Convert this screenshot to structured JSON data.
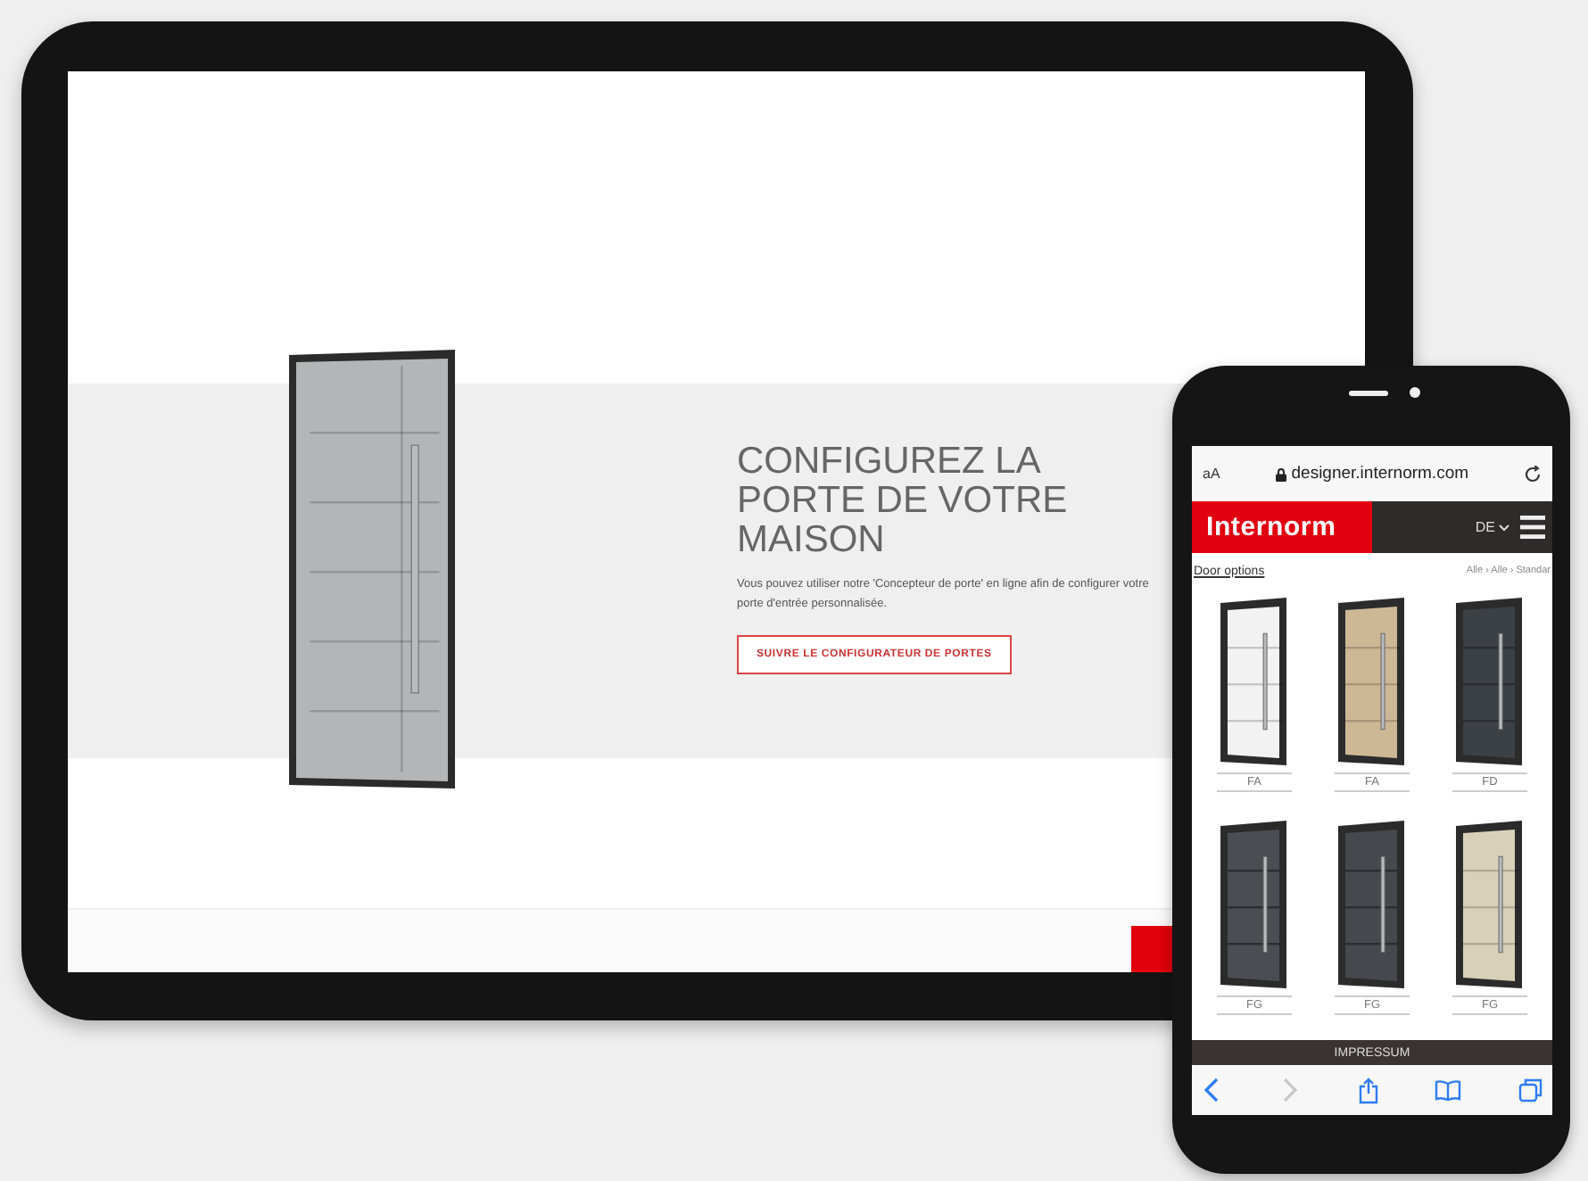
{
  "tablet": {
    "hero": {
      "title": "CONFIGUREZ LA PORTE DE VOTRE MAISON",
      "text": "Vous pouvez utiliser notre 'Concepteur de porte' en ligne afin de configurer votre porte d'entrée personnalisée.",
      "button": "SUIVRE LE CONFIGURATEUR DE PORTES"
    }
  },
  "phone": {
    "browser": {
      "text_size": "aA",
      "url": "designer.internorm.com"
    },
    "header": {
      "logo": "Internorm",
      "language": "DE"
    },
    "tab": "Door options",
    "breadcrumb": "Alle › Alle › Standar",
    "doors": [
      {
        "label": "FA",
        "color": "#f2f2f2"
      },
      {
        "label": "FA",
        "color": "#cdb896"
      },
      {
        "label": "FD",
        "color": "#3c4146"
      },
      {
        "label": "FG",
        "color": "#4a4e53"
      },
      {
        "label": "FG",
        "color": "#45494e"
      },
      {
        "label": "FG",
        "color": "#d8d0b8"
      }
    ],
    "footer": "IMPRESSUM",
    "toolbar": [
      {
        "kind": "back",
        "disabled": false
      },
      {
        "kind": "forward",
        "disabled": true
      },
      {
        "kind": "share",
        "disabled": false
      },
      {
        "kind": "bookmarks",
        "disabled": false
      },
      {
        "kind": "tabs",
        "disabled": false
      }
    ]
  }
}
